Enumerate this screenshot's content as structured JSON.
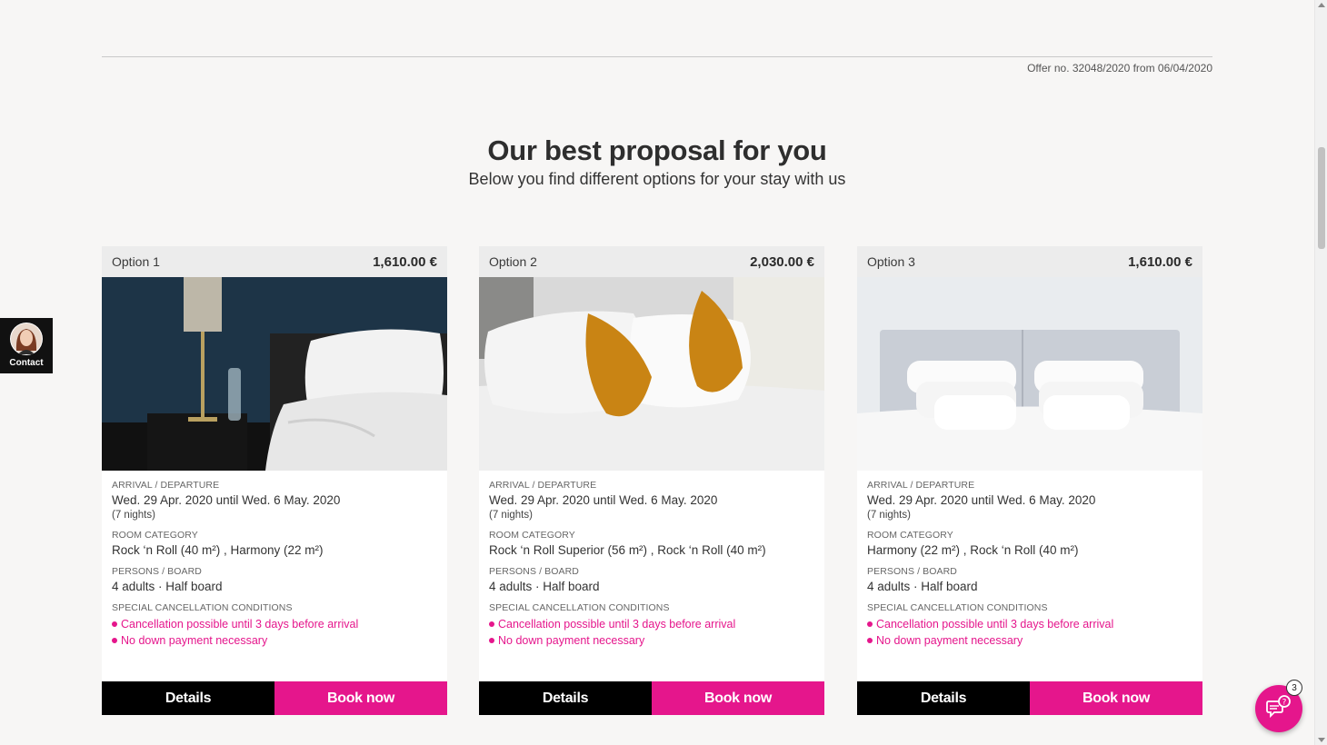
{
  "offer": {
    "number_text": "Offer no. 32048/2020 from 06/04/2020"
  },
  "heading": {
    "title": "Our best proposal for you",
    "subtitle": "Below you find different options for your stay with us"
  },
  "labels": {
    "arrival": "ARRIVAL / DEPARTURE",
    "room": "ROOM CATEGORY",
    "persons": "PERSONS / BOARD",
    "cancellation": "SPECIAL CANCELLATION CONDITIONS",
    "details_button": "Details",
    "book_button": "Book now"
  },
  "options": [
    {
      "label": "Option 1",
      "price": "1,610.00 €",
      "dates": "Wed. 29 Apr. 2020 until Wed. 6 May. 2020",
      "nights": "(7 nights)",
      "rooms": "Rock ‘n Roll (40 m²) , Harmony (22 m²)",
      "persons": "4 adults · Half board",
      "conditions": [
        "Cancellation possible until 3 days before arrival",
        "No down payment necessary"
      ]
    },
    {
      "label": "Option 2",
      "price": "2,030.00 €",
      "dates": "Wed. 29 Apr. 2020 until Wed. 6 May. 2020",
      "nights": "(7 nights)",
      "rooms": "Rock ‘n Roll Superior (56 m²) , Rock ‘n Roll (40 m²)",
      "persons": "4 adults · Half board",
      "conditions": [
        "Cancellation possible until 3 days before arrival",
        "No down payment necessary"
      ]
    },
    {
      "label": "Option 3",
      "price": "1,610.00 €",
      "dates": "Wed. 29 Apr. 2020 until Wed. 6 May. 2020",
      "nights": "(7 nights)",
      "rooms": "Harmony (22 m²) , Rock ‘n Roll (40 m²)",
      "persons": "4 adults · Half board",
      "conditions": [
        "Cancellation possible until 3 days before arrival",
        "No down payment necessary"
      ]
    }
  ],
  "contact": {
    "label": "Contact"
  },
  "chat": {
    "badge_count": "3",
    "icon": "chat-help-icon"
  },
  "colors": {
    "accent": "#e5168c",
    "dark": "#000000",
    "card_header": "#ececec",
    "background": "#f7f6f5"
  }
}
